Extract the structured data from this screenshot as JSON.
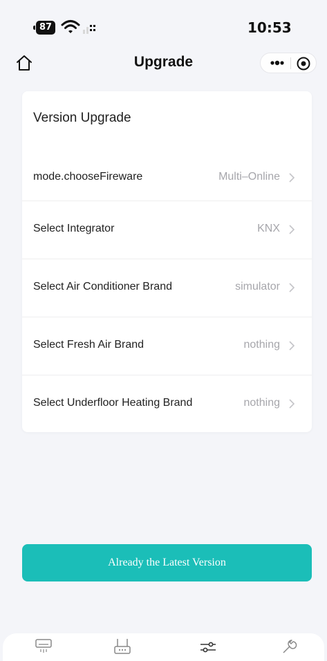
{
  "status_bar": {
    "battery": "87",
    "time": "10:53",
    "icons": [
      "wifi-icon",
      "signal-icon"
    ]
  },
  "nav": {
    "title": "Upgrade",
    "left_icon": "home-icon",
    "right_icons": [
      "more-icon",
      "target-icon"
    ]
  },
  "card": {
    "title": "Version Upgrade",
    "rows": [
      {
        "label": "mode.chooseFireware",
        "value": "Multi–Online"
      },
      {
        "label": "Select Integrator",
        "value": "KNX"
      },
      {
        "label": "Select Air Conditioner Brand",
        "value": "simulator"
      },
      {
        "label": "Select Fresh Air Brand",
        "value": "nothing"
      },
      {
        "label": "Select Underfloor Heating Brand",
        "value": "nothing"
      }
    ],
    "chevron": ">"
  },
  "primary_button": {
    "label": "Already the Latest Version"
  },
  "tab_bar": {
    "tabs": [
      "air-conditioner-icon",
      "device-icon",
      "sliders-icon",
      "wrench-icon"
    ],
    "active_index": 2
  },
  "colors": {
    "accent": "#1bbeb8",
    "background": "#f4f5f9",
    "value_text": "#a6a6ab"
  }
}
